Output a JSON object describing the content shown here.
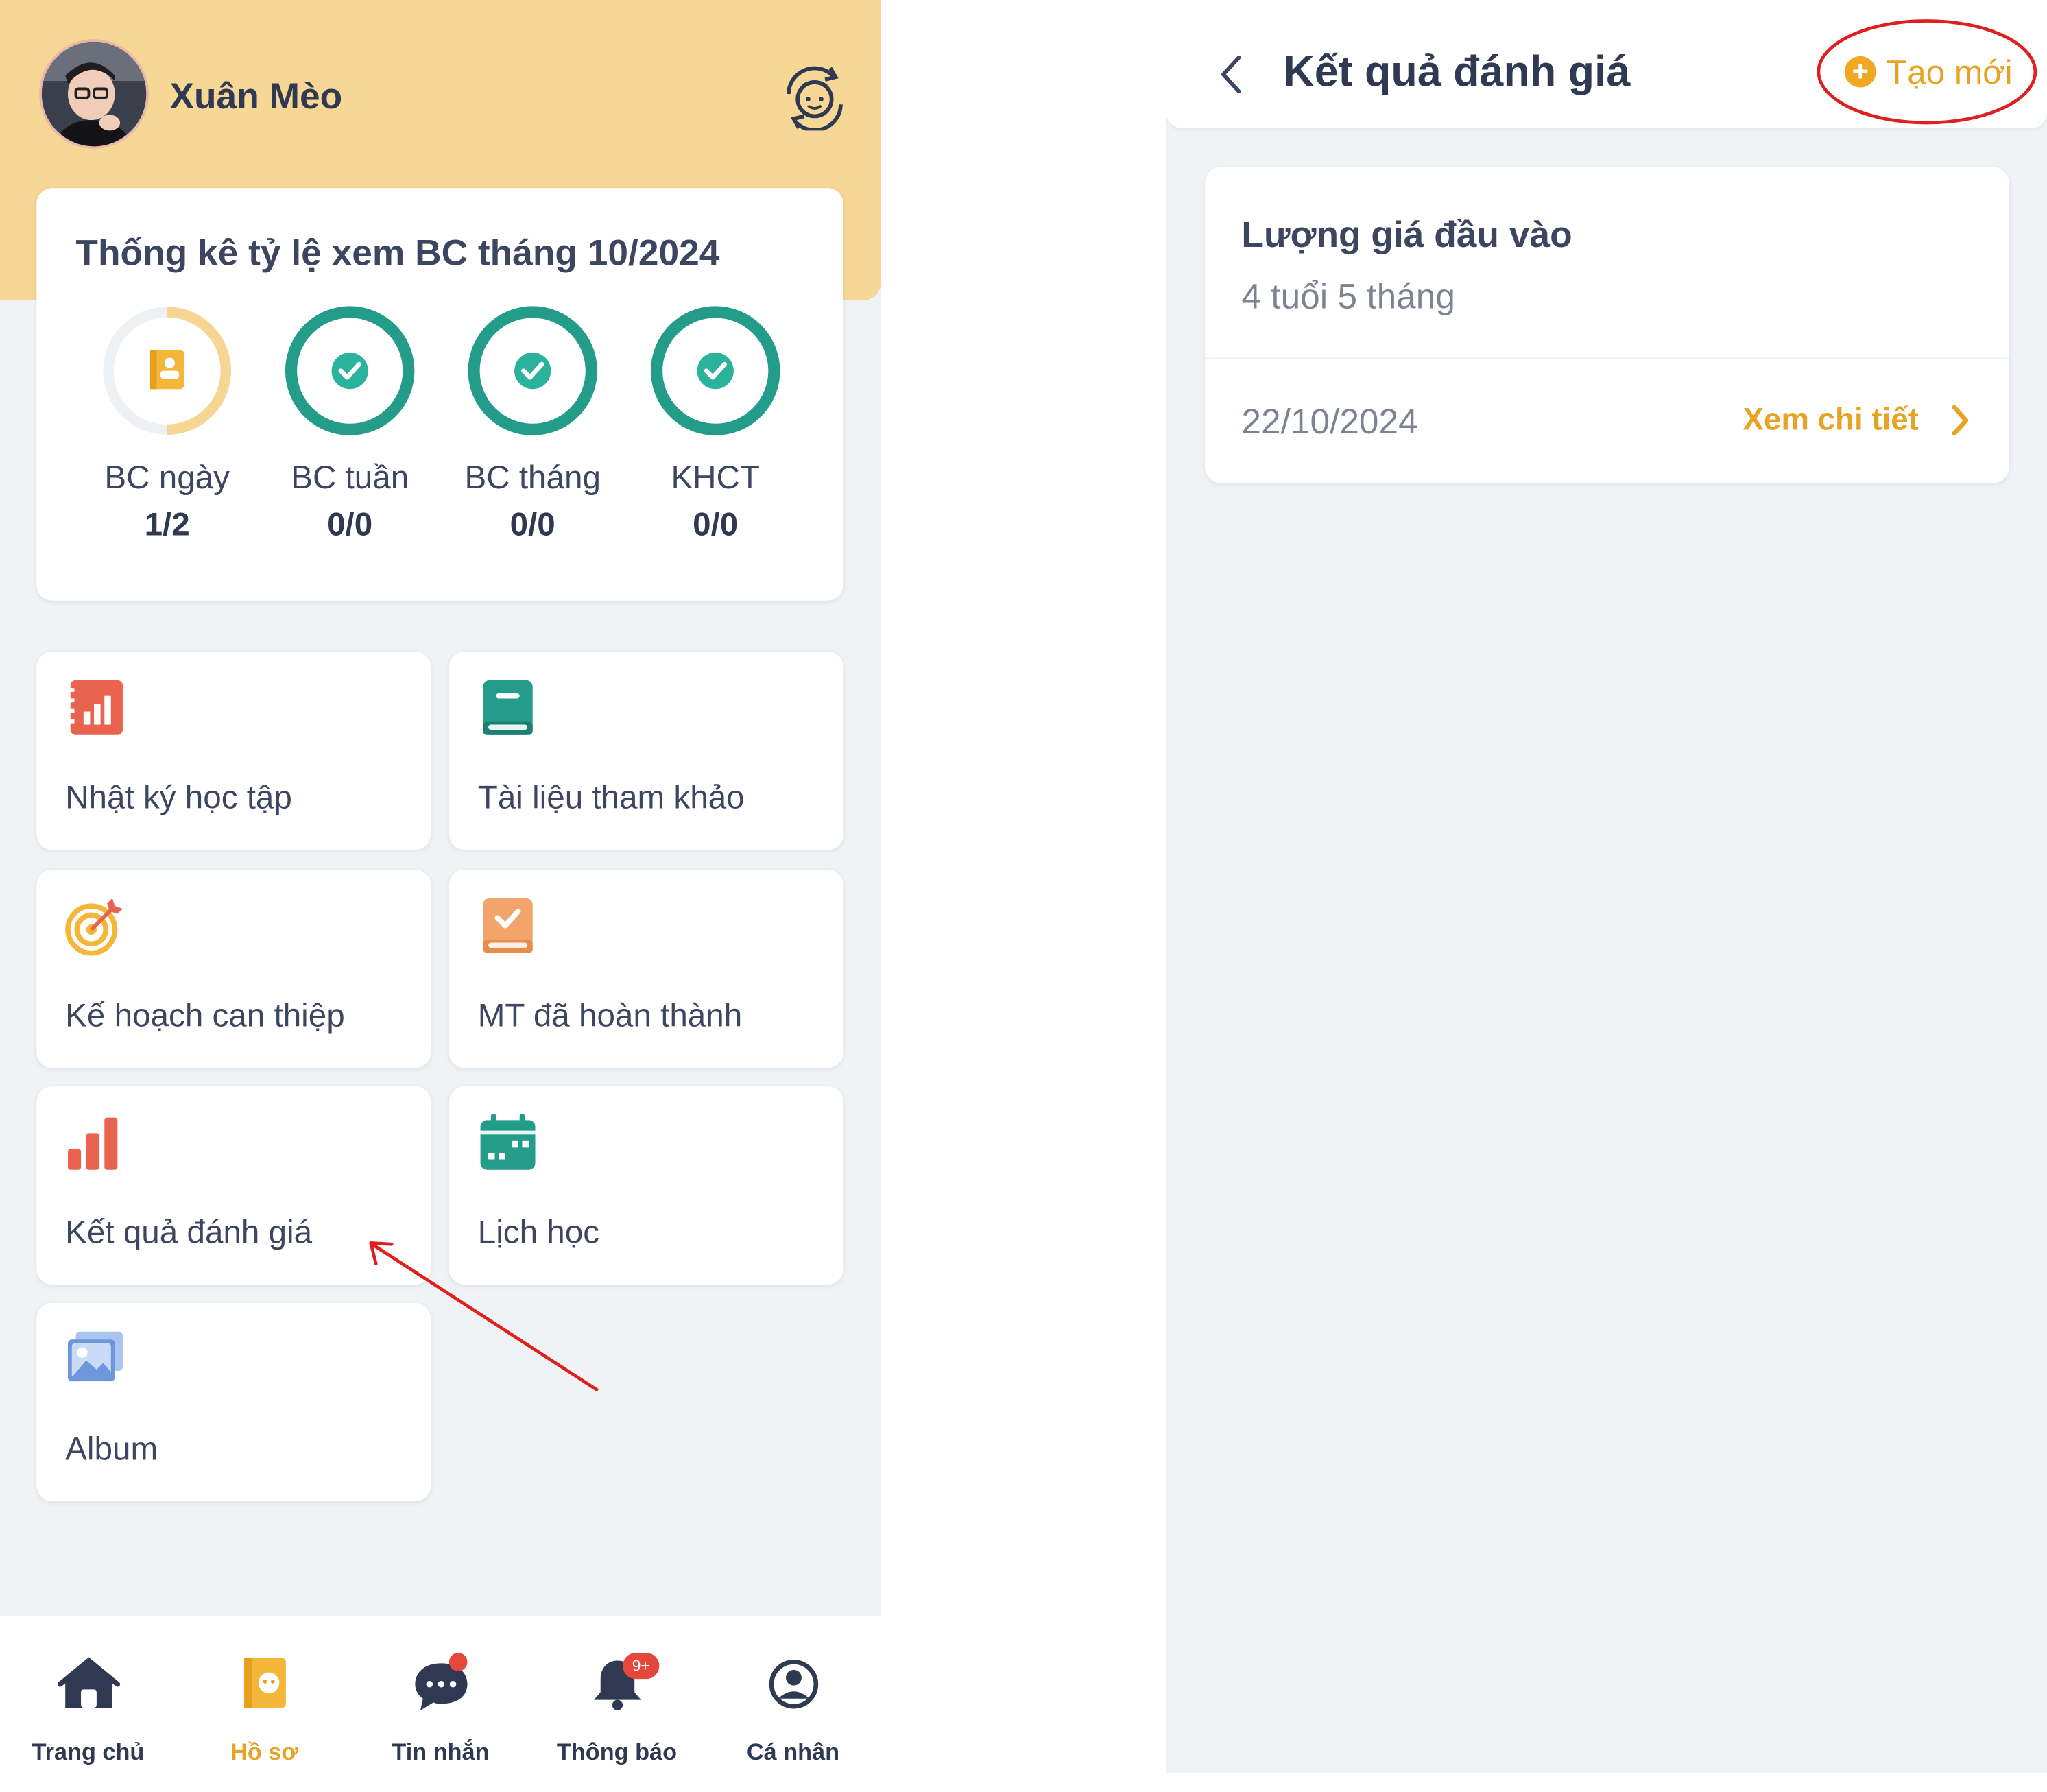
{
  "profile": {
    "name": "Xuân Mèo"
  },
  "stats": {
    "title": "Thống kê tỷ lệ xem BC tháng 10/2024",
    "items": [
      {
        "label": "BC ngày",
        "value": "1/2",
        "progress": 0.5,
        "state": "partial"
      },
      {
        "label": "BC tuần",
        "value": "0/0",
        "progress": 1.0,
        "state": "done"
      },
      {
        "label": "BC tháng",
        "value": "0/0",
        "progress": 1.0,
        "state": "done"
      },
      {
        "label": "KHCT",
        "value": "0/0",
        "progress": 1.0,
        "state": "done"
      }
    ]
  },
  "menu": [
    {
      "label": "Nhật ký học tập",
      "icon": "learning-diary-icon"
    },
    {
      "label": "Tài liệu tham khảo",
      "icon": "reference-book-icon"
    },
    {
      "label": "Kế hoạch can thiệp",
      "icon": "target-icon"
    },
    {
      "label": "MT đã hoàn thành",
      "icon": "completed-goals-icon"
    },
    {
      "label": "Kết quả đánh giá",
      "icon": "bar-chart-icon"
    },
    {
      "label": "Lịch học",
      "icon": "calendar-icon"
    },
    {
      "label": "Album",
      "icon": "album-icon"
    }
  ],
  "bottom_nav": [
    {
      "label": "Trang chủ",
      "icon": "home-icon",
      "active": false
    },
    {
      "label": "Hồ sơ",
      "icon": "profile-book-icon",
      "active": true
    },
    {
      "label": "Tin nhắn",
      "icon": "chat-icon",
      "active": false
    },
    {
      "label": "Thông báo",
      "icon": "bell-icon",
      "active": false,
      "badge": "9+"
    },
    {
      "label": "Cá nhân",
      "icon": "user-circle-icon",
      "active": false
    }
  ],
  "result_page": {
    "title": "Kết quả đánh giá",
    "create_label": "Tạo mới",
    "cards": [
      {
        "title": "Lượng giá đầu vào",
        "subtitle": "4 tuổi 5 tháng",
        "date": "22/10/2024",
        "link": "Xem chi tiết"
      }
    ]
  },
  "colors": {
    "header_bg": "#f6d796",
    "accent": "#e8a324",
    "teal": "#249c8a",
    "coral": "#e9634e",
    "annotation": "#e0201e"
  }
}
